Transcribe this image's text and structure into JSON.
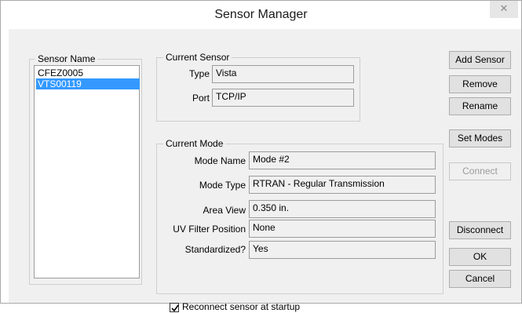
{
  "window": {
    "title": "Sensor Manager",
    "close_glyph": "✕"
  },
  "sensor_list": {
    "label": "Sensor Name",
    "items": [
      {
        "name": "CFEZ0005",
        "selected": false
      },
      {
        "name": "VTS00119",
        "selected": true
      }
    ]
  },
  "current_sensor": {
    "label": "Current Sensor",
    "type_label": "Type",
    "type_value": "Vista",
    "port_label": "Port",
    "port_value": "TCP/IP"
  },
  "current_mode": {
    "label": "Current Mode",
    "fields": [
      {
        "label": "Mode Name",
        "value": "Mode #2"
      },
      {
        "label": "Mode Type",
        "value": "RTRAN - Regular Transmission"
      },
      {
        "label": "Area View",
        "value": "0.350 in."
      },
      {
        "label": "UV Filter Position",
        "value": "None"
      },
      {
        "label": "Standardized?",
        "value": "Yes"
      }
    ]
  },
  "buttons": {
    "add_sensor": "Add Sensor",
    "remove": "Remove",
    "rename": "Rename",
    "set_modes": "Set Modes",
    "connect": "Connect",
    "disconnect": "Disconnect",
    "ok": "OK",
    "cancel": "Cancel"
  },
  "reconnect": {
    "label": "Reconnect sensor at startup",
    "checked": true
  },
  "colors": {
    "selection": "#3399ff",
    "disabled_text": "#9a9a9a"
  }
}
